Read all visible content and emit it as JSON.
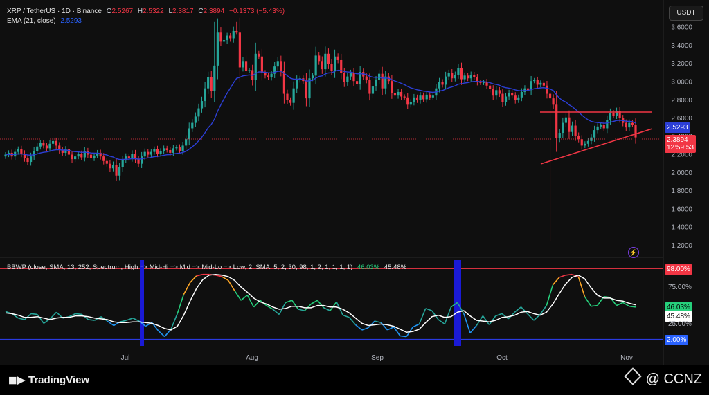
{
  "header": {
    "symbol": "XRP / TetherUS · 1D · Binance",
    "ohlc": {
      "o_label": "O",
      "o": "2.5267",
      "h_label": "H",
      "h": "2.5322",
      "l_label": "L",
      "l": "2.3817",
      "c_label": "C",
      "c": "2.3894",
      "change": "−0.1373 (−5.43%)"
    },
    "ema_label": "EMA (21, close)",
    "ema_value": "2.5293",
    "currency_button": "USDT"
  },
  "indicator": {
    "label": "BBWP (close, SMA, 13, 252, Spectrum, High => Mid-Hi => Mid => Mid-Lo => Low, 2, SMA, 5, 2, 30, 98, 1, 2, 1, 1, 1, 1)",
    "value_green": "46.03%",
    "value_white": "45.48%",
    "ticks": [
      "98.00%",
      "75.00%",
      "50.00%",
      "25.00%",
      "2.00%"
    ],
    "current_green_label": "46.03%",
    "current_white_label": "45.48%"
  },
  "price_labels": {
    "ema": "2.5293",
    "last": "2.3894",
    "countdown": "12:59:53"
  },
  "colors": {
    "up": "#26a69a",
    "down": "#f23645",
    "ema": "#2c3fd6",
    "background": "#0f0f0f",
    "annotation": "#f23645"
  },
  "footer": {
    "logo": "TradingView",
    "brand": "@ CCNZ"
  },
  "chart_data": [
    {
      "type": "candlestick",
      "title": "XRP / TetherUS · 1D · Binance",
      "x_labels": [
        "Jul",
        "Aug",
        "Sep",
        "Oct",
        "Nov"
      ],
      "yticks": [
        1.2,
        1.4,
        1.6,
        1.8,
        2.0,
        2.2,
        2.4,
        2.6,
        2.8,
        3.0,
        3.2,
        3.4,
        3.6
      ],
      "ylim": [
        1.1,
        3.75
      ],
      "grid": false,
      "closes": [
        2.2,
        2.22,
        2.18,
        2.23,
        2.26,
        2.21,
        2.16,
        2.12,
        2.18,
        2.24,
        2.29,
        2.33,
        2.3,
        2.27,
        2.32,
        2.35,
        2.3,
        2.25,
        2.22,
        2.26,
        2.2,
        2.15,
        2.18,
        2.21,
        2.17,
        2.24,
        2.2,
        2.16,
        2.19,
        2.22,
        2.18,
        2.13,
        2.1,
        2.05,
        2.09,
        1.97,
        2.06,
        2.14,
        2.18,
        2.16,
        2.21,
        2.15,
        2.1,
        2.18,
        2.23,
        2.2,
        2.23,
        2.26,
        2.21,
        2.24,
        2.27,
        2.25,
        2.22,
        2.27,
        2.28,
        2.24,
        2.3,
        2.37,
        2.49,
        2.55,
        2.62,
        2.71,
        2.79,
        2.93,
        3.05,
        2.9,
        3.18,
        3.55,
        3.45,
        3.46,
        3.51,
        3.48,
        3.56,
        3.55,
        3.16,
        3.23,
        3.12,
        3.13,
        3.02,
        3.31,
        3.28,
        3.1,
        3.07,
        3.05,
        3.09,
        3.17,
        3.23,
        3.12,
        2.87,
        2.8,
        2.77,
        2.93,
        3.02,
        3.04,
        3.01,
        2.82,
        3.04,
        3.07,
        3.29,
        3.23,
        3.14,
        3.31,
        3.2,
        3.12,
        3.28,
        3.24,
        3.1,
        3.0,
        3.06,
        3.1,
        3.01,
        2.98,
        3.11,
        3.06,
        3.02,
        2.87,
        2.95,
        3.02,
        3.09,
        2.93,
        3.06,
        3.01,
        2.88,
        2.85,
        2.89,
        2.84,
        2.83,
        2.75,
        2.78,
        2.83,
        2.8,
        2.85,
        2.81,
        2.86,
        2.83,
        2.85,
        2.93,
        3.0,
        2.97,
        3.06,
        3.1,
        3.04,
        3.08,
        3.15,
        3.03,
        3.07,
        3.04,
        3.08,
        3.05,
        3.0,
        2.99,
        3.0,
        2.96,
        2.92,
        2.85,
        2.91,
        2.87,
        2.78,
        2.84,
        2.88,
        2.85,
        2.8,
        2.83,
        2.89,
        2.93,
        2.91,
        3.01,
        3.02,
        2.97,
        2.99,
        2.96,
        2.87,
        2.82,
        2.75,
        2.38,
        2.44,
        2.55,
        2.61,
        2.45,
        2.52,
        2.41,
        2.37,
        2.3,
        2.32,
        2.35,
        2.39,
        2.47,
        2.51,
        2.53,
        2.49,
        2.58,
        2.66,
        2.63,
        2.68,
        2.6,
        2.55,
        2.5,
        2.55,
        2.53,
        2.39
      ]
    },
    {
      "type": "line",
      "title": "BBWP (close, SMA, 13, 252, Spectrum, High => Mid-Hi => Mid => Mid-Lo => Low, 2, SMA, 5, 2, 30, 98, 1, 2, 1, 1, 1, 1)",
      "ylim": [
        0,
        100
      ],
      "yticks": [
        98,
        75,
        50,
        25,
        2
      ],
      "series": [
        {
          "values": [
            40,
            37,
            31,
            29,
            37,
            36,
            24,
            30,
            39,
            31,
            33,
            37,
            36,
            29,
            28,
            33,
            27,
            21,
            26,
            28,
            31,
            27,
            20,
            25,
            14,
            6,
            16,
            37,
            63,
            79,
            88,
            90,
            90,
            89,
            87,
            82,
            68,
            55,
            62,
            46,
            55,
            48,
            43,
            36,
            52,
            55,
            43,
            41,
            50,
            55,
            45,
            41,
            53,
            35,
            32,
            22,
            15,
            18,
            27,
            25,
            15,
            19,
            7,
            6,
            19,
            23,
            44,
            41,
            29,
            23,
            46,
            52,
            37,
            11,
            21,
            34,
            22,
            34,
            37,
            30,
            39,
            46,
            37,
            28,
            36,
            48,
            76,
            86,
            89,
            90,
            87,
            60,
            47,
            48,
            60,
            59,
            48,
            52,
            47,
            46
          ]
        },
        {
          "values": [
            38,
            37,
            35,
            32,
            32,
            33,
            31,
            29,
            31,
            32,
            32,
            34,
            34,
            33,
            31,
            30,
            29,
            26,
            25,
            25,
            26,
            26,
            25,
            24,
            21,
            17,
            15,
            20,
            35,
            54,
            71,
            83,
            89,
            90,
            89,
            87,
            82,
            73,
            66,
            58,
            53,
            50,
            46,
            43,
            44,
            47,
            47,
            45,
            45,
            48,
            48,
            46,
            46,
            43,
            38,
            31,
            24,
            21,
            22,
            23,
            22,
            20,
            16,
            12,
            13,
            16,
            25,
            33,
            35,
            32,
            33,
            39,
            41,
            34,
            28,
            27,
            26,
            28,
            32,
            33,
            35,
            39,
            40,
            37,
            35,
            39,
            50,
            64,
            77,
            86,
            89,
            84,
            72,
            62,
            58,
            58,
            55,
            54,
            51,
            49
          ]
        }
      ]
    }
  ]
}
